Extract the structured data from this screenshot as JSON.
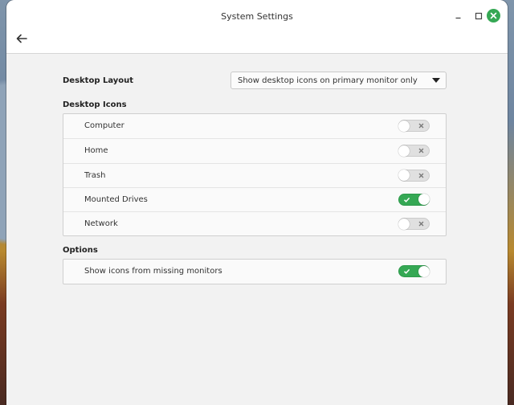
{
  "window": {
    "title": "System Settings"
  },
  "desktop_layout": {
    "label": "Desktop Layout",
    "selected": "Show desktop icons on primary monitor only"
  },
  "desktop_icons": {
    "heading": "Desktop Icons",
    "items": [
      {
        "label": "Computer",
        "enabled": false
      },
      {
        "label": "Home",
        "enabled": false
      },
      {
        "label": "Trash",
        "enabled": false
      },
      {
        "label": "Mounted Drives",
        "enabled": true
      },
      {
        "label": "Network",
        "enabled": false
      }
    ]
  },
  "options": {
    "heading": "Options",
    "items": [
      {
        "label": "Show icons from missing monitors",
        "enabled": true
      }
    ]
  },
  "colors": {
    "accent": "#35a854",
    "switch_off": "#e0e0e0"
  }
}
